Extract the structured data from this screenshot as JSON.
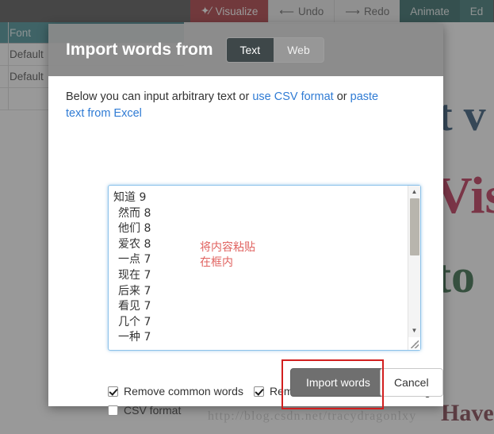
{
  "toolbar": {
    "buttons": [
      {
        "label": "Visualize",
        "icon": "wand-sparkle-icon",
        "style": "visualize"
      },
      {
        "label": "Undo",
        "icon": "arrow-left-icon",
        "style": "plain"
      },
      {
        "label": "Redo",
        "icon": "arrow-right-icon",
        "style": "plain"
      },
      {
        "label": "Animate",
        "icon": "",
        "style": "animate"
      },
      {
        "label": "Ed",
        "icon": "",
        "style": "edit"
      }
    ]
  },
  "background_table": {
    "header": "Font",
    "rows": [
      "Default",
      "Default"
    ]
  },
  "background_cloud": {
    "words": [
      "t v",
      "Vis",
      "to",
      "Have"
    ]
  },
  "watermark": "http://blog.csdn.net/tracydragonlxy",
  "dialog": {
    "title": "Import words from",
    "source_tabs": [
      {
        "label": "Text",
        "active": true
      },
      {
        "label": "Web",
        "active": false
      }
    ],
    "instruction": {
      "part1": "Below you can input arbitrary text or ",
      "link1": "use CSV format",
      "part2": " or ",
      "link2": "paste text from Excel"
    },
    "textarea": {
      "lines": [
        "知道 9",
        "然而 8",
        "他们 8",
        "爱农 8",
        "一点 7",
        "现在 7",
        "后来 7",
        "看见 7",
        "几个 7",
        "一种 7"
      ],
      "annotation": "将内容粘贴\n在框内",
      "scrollbar": {
        "up_arrow": "▲",
        "down_arrow": "▼"
      }
    },
    "options": [
      {
        "label": "Remove common words",
        "checked": true
      },
      {
        "label": "Remove numbers",
        "checked": true
      },
      {
        "label": "Stemming",
        "checked": true
      },
      {
        "label": "CSV format",
        "checked": false
      }
    ],
    "buttons": {
      "import": "Import words",
      "cancel": "Cancel"
    }
  },
  "colors": {
    "visualize": "#a01c22",
    "animate": "#11514f",
    "table_header": "#2a7f87",
    "link": "#2f7bd4",
    "annotation_red": "#e0625f",
    "highlight_red": "#d21f1f",
    "import_button": "#6f6f6f"
  }
}
